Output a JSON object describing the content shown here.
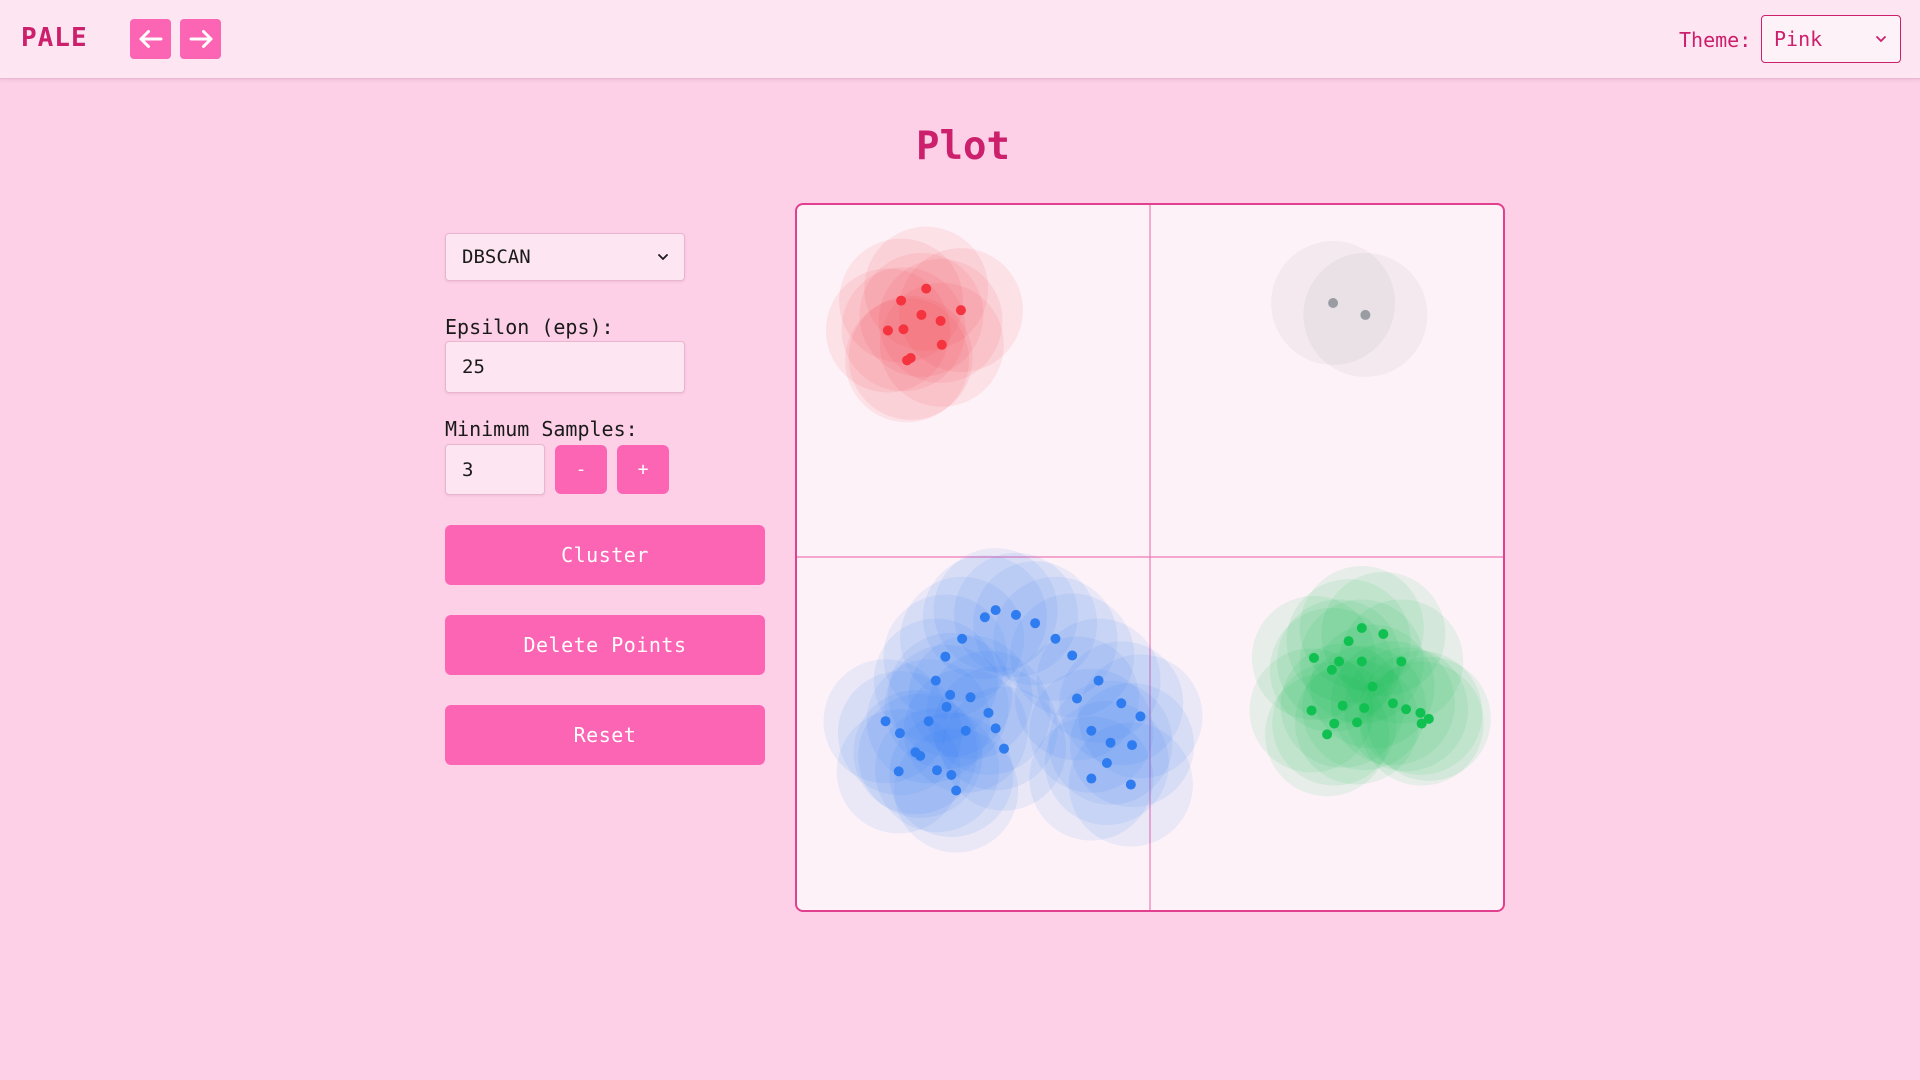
{
  "app": {
    "brand": "PALE",
    "theme_label": "Theme:",
    "theme_value": "Pink",
    "nav_back_icon": "arrow-left-icon",
    "nav_forward_icon": "arrow-right-icon"
  },
  "page": {
    "title": "Plot"
  },
  "controls": {
    "algorithm": "DBSCAN",
    "eps_label": "Epsilon (eps):",
    "eps_value": "25",
    "min_samples_label": "Minimum Samples:",
    "min_samples_value": "3",
    "decrement_label": "-",
    "increment_label": "+",
    "cluster_label": "Cluster",
    "delete_label": "Delete Points",
    "reset_label": "Reset"
  },
  "colors": {
    "accent": "#fc64b4",
    "brand": "#cc1f6c",
    "cluster_red": "#f5343f",
    "cluster_blue": "#2f7cf0",
    "cluster_green": "#10c152",
    "noise_gray": "#9a9ca3"
  },
  "chart_data": {
    "type": "scatter",
    "xlim": [
      0,
      590
    ],
    "ylim": [
      0,
      590
    ],
    "grid": "quadrant lines at center",
    "series": [
      {
        "cluster": "red",
        "points": [
          [
            87,
            80
          ],
          [
            108,
            70
          ],
          [
            104,
            92
          ],
          [
            120,
            97
          ],
          [
            137,
            88
          ],
          [
            76,
            105
          ],
          [
            89,
            104
          ],
          [
            121,
            117
          ],
          [
            95,
            128
          ],
          [
            92,
            130
          ]
        ]
      },
      {
        "cluster": "gray-noise",
        "points": [
          [
            448,
            82
          ],
          [
            475,
            92
          ]
        ]
      },
      {
        "cluster": "blue",
        "points": [
          [
            166,
            339
          ],
          [
            157,
            345
          ],
          [
            183,
            343
          ],
          [
            199,
            350
          ],
          [
            216,
            363
          ],
          [
            230,
            377
          ],
          [
            138,
            363
          ],
          [
            124,
            378
          ],
          [
            116,
            398
          ],
          [
            128,
            410
          ],
          [
            110,
            432
          ],
          [
            141,
            440
          ],
          [
            125,
            420
          ],
          [
            160,
            425
          ],
          [
            74,
            432
          ],
          [
            86,
            442
          ],
          [
            103,
            461
          ],
          [
            99,
            458
          ],
          [
            145,
            412
          ],
          [
            166,
            438
          ],
          [
            173,
            455
          ],
          [
            129,
            477
          ],
          [
            117,
            473
          ],
          [
            85,
            474
          ],
          [
            133,
            490
          ],
          [
            234,
            413
          ],
          [
            252,
            398
          ],
          [
            271,
            417
          ],
          [
            287,
            428
          ],
          [
            246,
            440
          ],
          [
            262,
            450
          ],
          [
            280,
            452
          ],
          [
            259,
            467
          ],
          [
            246,
            480
          ],
          [
            279,
            485
          ]
        ]
      },
      {
        "cluster": "green",
        "points": [
          [
            472,
            354
          ],
          [
            490,
            359
          ],
          [
            461,
            365
          ],
          [
            432,
            379
          ],
          [
            453,
            382
          ],
          [
            472,
            382
          ],
          [
            505,
            382
          ],
          [
            447,
            389
          ],
          [
            481,
            403
          ],
          [
            528,
            430
          ],
          [
            521,
            425
          ],
          [
            498,
            417
          ],
          [
            456,
            419
          ],
          [
            474,
            421
          ],
          [
            509,
            422
          ],
          [
            522,
            434
          ],
          [
            430,
            423
          ],
          [
            449,
            434
          ],
          [
            468,
            433
          ],
          [
            443,
            443
          ]
        ]
      }
    ]
  }
}
